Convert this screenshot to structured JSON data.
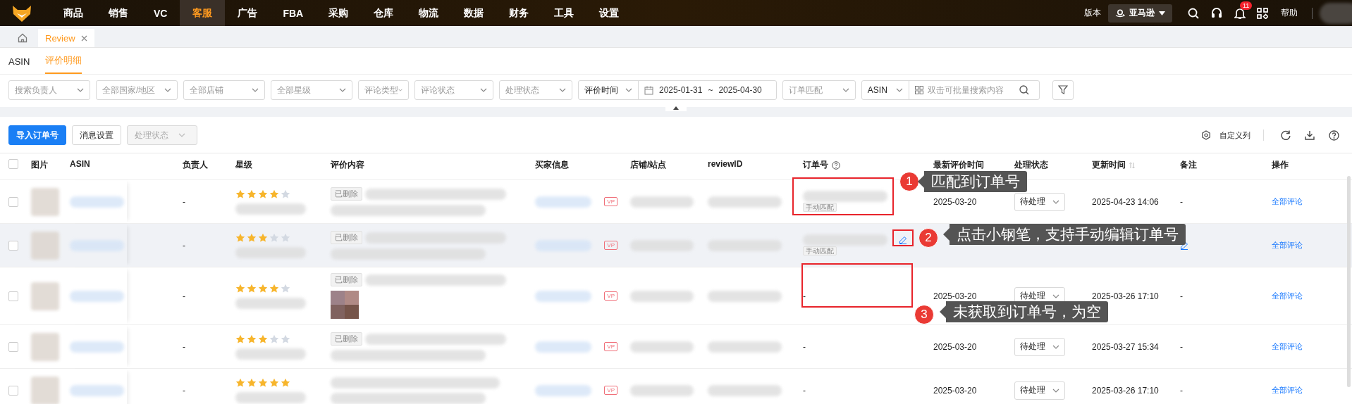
{
  "nav": {
    "items": [
      {
        "label": "商品",
        "selected": false
      },
      {
        "label": "销售",
        "selected": false
      },
      {
        "label": "VC",
        "selected": false
      },
      {
        "label": "客服",
        "selected": true
      },
      {
        "label": "广告",
        "selected": false
      },
      {
        "label": "FBA",
        "selected": false
      },
      {
        "label": "采购",
        "selected": false
      },
      {
        "label": "仓库",
        "selected": false
      },
      {
        "label": "物流",
        "selected": false
      },
      {
        "label": "数据",
        "selected": false
      },
      {
        "label": "财务",
        "selected": false
      },
      {
        "label": "工具",
        "selected": false
      },
      {
        "label": "设置",
        "selected": false
      }
    ],
    "version_label": "版本",
    "platform": "亚马逊",
    "notification_count": "11",
    "help": "帮助"
  },
  "page_tabs": [
    {
      "label": "Review",
      "selected": true
    }
  ],
  "sub_tabs": [
    {
      "label": "ASIN",
      "selected": false
    },
    {
      "label": "评价明细",
      "selected": true
    }
  ],
  "filters": [
    {
      "kind": "select",
      "placeholder": "搜索负责人"
    },
    {
      "kind": "select",
      "placeholder": "全部国家/地区"
    },
    {
      "kind": "select",
      "placeholder": "全部店铺"
    },
    {
      "kind": "select",
      "placeholder": "全部星级"
    },
    {
      "kind": "select",
      "placeholder": "评论类型"
    },
    {
      "kind": "select",
      "placeholder": "评论状态"
    },
    {
      "kind": "select",
      "placeholder": "处理状态"
    },
    {
      "kind": "daterange",
      "label": "评价时间",
      "start": "2025-01-31",
      "separator": "~",
      "end": "2025-04-30"
    },
    {
      "kind": "select",
      "placeholder": "订单匹配"
    },
    {
      "kind": "search",
      "field": "ASIN",
      "placeholder": "双击可批量搜索内容"
    }
  ],
  "toolbar": {
    "buttons": [
      {
        "label": "导入订单号",
        "kind": "primary",
        "disabled": false
      },
      {
        "label": "消息设置",
        "kind": "default",
        "disabled": false
      },
      {
        "label": "处理状态",
        "kind": "dropdown",
        "disabled": true
      }
    ],
    "custom_columns": "自定义列"
  },
  "table": {
    "select_all_checked": false,
    "columns": [
      "图片",
      "ASIN",
      "负责人",
      "星级",
      "评价内容",
      "买家信息",
      "店铺/站点",
      "reviewID",
      "订单号",
      "最新评价时间",
      "处理状态",
      "更新时间",
      "备注",
      "操作"
    ],
    "rows": [
      {
        "checked": false,
        "owner": "-",
        "stars": 4,
        "deleted_tag": "已删除",
        "has_photo": false,
        "vp": "VP",
        "order_tag": "手动匹配",
        "order_editable": false,
        "order_number": null,
        "latest_time": "2025-03-20",
        "status": "待处理",
        "updated": "2025-04-23 14:06",
        "remark": "-",
        "remark_editable": false,
        "action": "全部评论",
        "hovered": false
      },
      {
        "checked": false,
        "owner": "-",
        "stars": 3,
        "deleted_tag": "已删除",
        "has_photo": false,
        "vp": "VP",
        "order_tag": "手动匹配",
        "order_editable": true,
        "order_number": null,
        "latest_time": null,
        "status": null,
        "updated": null,
        "remark": null,
        "remark_editable": true,
        "action": "全部评论",
        "hovered": true
      },
      {
        "checked": false,
        "owner": "-",
        "stars": 4,
        "deleted_tag": "已删除",
        "has_photo": true,
        "vp": "VP",
        "order_tag": null,
        "order_editable": false,
        "order_number": "-",
        "latest_time": "2025-03-20",
        "status": "待处理",
        "updated": "2025-03-26 17:10",
        "remark": "-",
        "remark_editable": false,
        "action": "全部评论",
        "hovered": false
      },
      {
        "checked": false,
        "owner": "-",
        "stars": 3,
        "deleted_tag": "已删除",
        "has_photo": false,
        "vp": "VP",
        "order_tag": null,
        "order_editable": false,
        "order_number": "-",
        "latest_time": "2025-03-20",
        "status": "待处理",
        "updated": "2025-03-27 15:34",
        "remark": "-",
        "remark_editable": false,
        "action": "全部评论",
        "hovered": false
      },
      {
        "checked": false,
        "owner": "-",
        "stars": 5,
        "deleted_tag": null,
        "has_photo": false,
        "vp": "VP",
        "order_tag": null,
        "order_editable": false,
        "order_number": "-",
        "latest_time": "2025-03-20",
        "status": "待处理",
        "updated": "2025-03-26 17:10",
        "remark": "-",
        "remark_editable": false,
        "action": "全部评论",
        "hovered": false
      }
    ]
  },
  "annotations": [
    {
      "number": "1",
      "text": "匹配到订单号"
    },
    {
      "number": "2",
      "text": "点击小钢笔，支持手动编辑订单号"
    },
    {
      "number": "3",
      "text": "未获取到订单号，为空"
    }
  ]
}
